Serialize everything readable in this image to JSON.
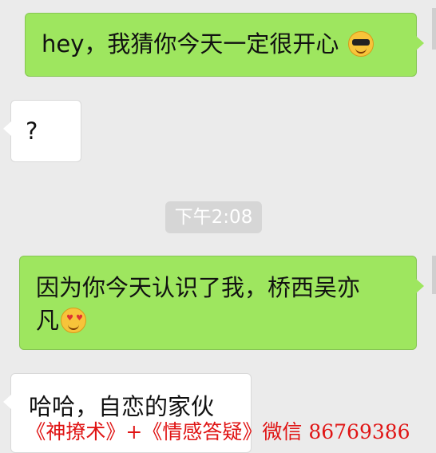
{
  "messages": [
    {
      "side": "outgoing",
      "text": "hey，我猜你今天一定很开心",
      "emoji": "cool-sunglasses"
    },
    {
      "side": "incoming",
      "text": "?"
    },
    {
      "side": "outgoing",
      "line1": "因为你今天认识了我，桥西吴亦",
      "line2": "凡",
      "emoji": "heart-eyes"
    },
    {
      "side": "incoming",
      "text": "哈哈，自恋的家伙"
    }
  ],
  "timestamp": "下午2:08",
  "watermark": "《神撩术》+《情感答疑》微信 86769386",
  "colors": {
    "background": "#ebebeb",
    "outgoing_bubble": "#9ee65f",
    "incoming_bubble": "#ffffff",
    "watermark": "#e01414"
  }
}
